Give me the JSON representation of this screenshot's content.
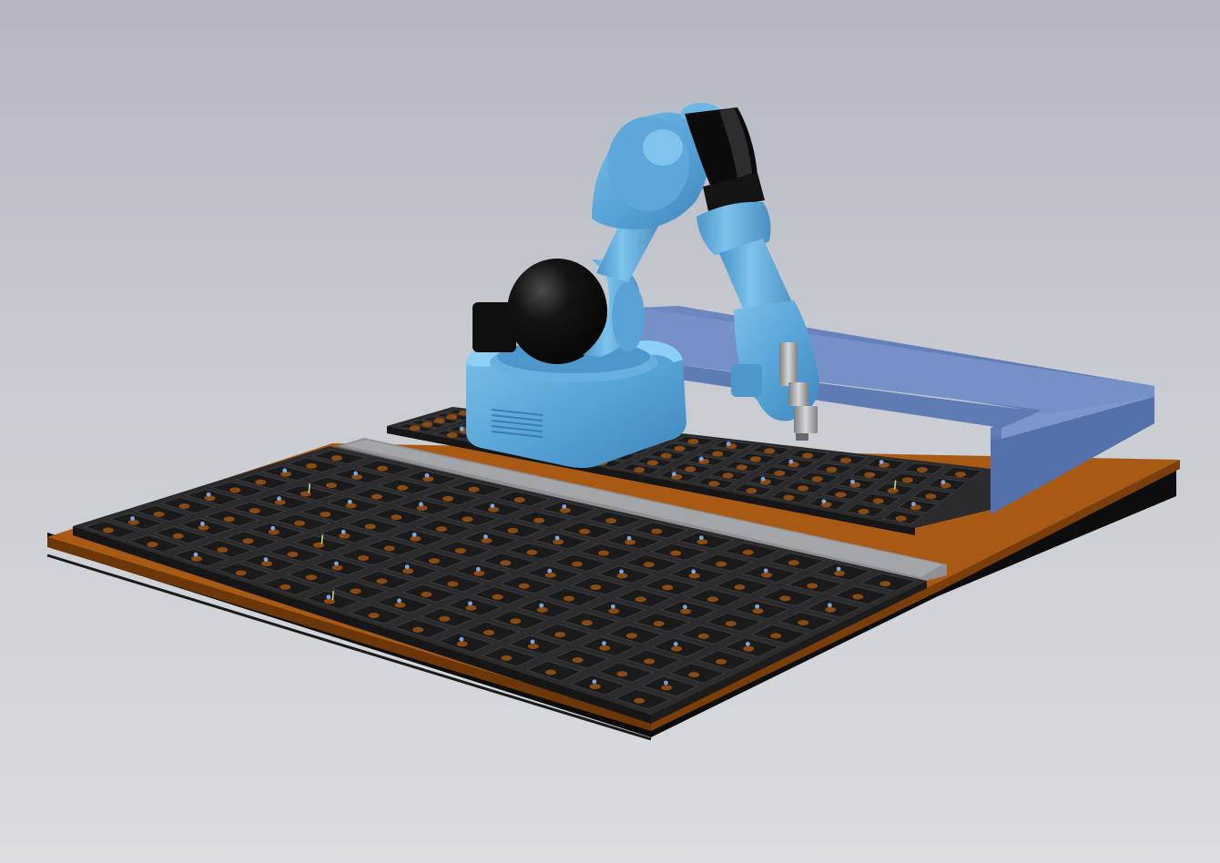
{
  "viewport": {
    "background_top": "#b3b7c0",
    "background_bottom": "#dadcdf"
  },
  "scene": {
    "objects": [
      {
        "name": "base-plate",
        "color": "#a85a14"
      },
      {
        "name": "front-plant-tray",
        "color": "#2b2b2d",
        "rows": 10,
        "cols": 13
      },
      {
        "name": "back-plant-tray",
        "color": "#2b2b2d",
        "rows": 5,
        "cols": 14
      },
      {
        "name": "conveyor-rail",
        "color": "#8f9093"
      },
      {
        "name": "l-shaped-fence",
        "color": "#6b86bd"
      },
      {
        "name": "robot-base",
        "color": "#5aa0d4"
      },
      {
        "name": "robot-arm",
        "color": "#5aa0d4"
      },
      {
        "name": "robot-joints",
        "color": "#0e0e0e"
      },
      {
        "name": "end-effector-tool",
        "color": "#a5a7a9"
      }
    ],
    "seedling_color": "#7ba7de",
    "sprout_color": "#c9e08a"
  }
}
